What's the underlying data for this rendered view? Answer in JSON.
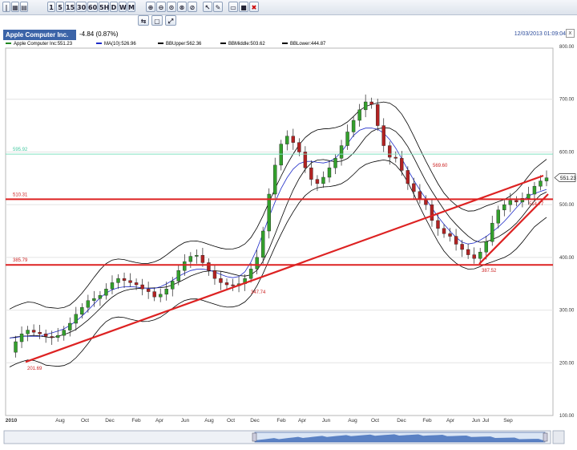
{
  "toolbar": {
    "buttons": [
      "1",
      "5",
      "15",
      "30",
      "60",
      "5H",
      "D",
      "W",
      "M"
    ]
  },
  "header": {
    "symbol": "Apple Computer Inc.",
    "change": "-4.84 (0.87%)",
    "datetime": "12/03/2013 01:09:04",
    "close": "x"
  },
  "legend": [
    {
      "label": "Apple Computer Inc:551.23",
      "color": "#228822"
    },
    {
      "label": "MA(10):526.96",
      "color": "#1f2cc8"
    },
    {
      "label": "BBUpper:562.36",
      "color": "#000000"
    },
    {
      "label": "BBMiddle:503.62",
      "color": "#000000"
    },
    {
      "label": "BBLower:444.87",
      "color": "#000000"
    }
  ],
  "colors": {
    "up": "#33a02c",
    "down": "#b22222",
    "ma": "#1f2cc8",
    "band": "#000000",
    "trend": "#dd2222",
    "cyan": "#7fe0bf"
  },
  "chart_data": {
    "type": "line",
    "title": "Apple Computer Inc",
    "y_ticks": [
      100,
      200,
      300,
      400,
      500,
      600,
      700,
      800
    ],
    "ylim": [
      100,
      830
    ],
    "x_ticks": [
      "2010",
      "Aug",
      "Oct",
      "Dec",
      "Feb",
      "Apr",
      "Jun",
      "Aug",
      "Oct",
      "Dec",
      "Feb",
      "Apr",
      "Jun",
      "Aug",
      "Oct",
      "Dec",
      "Feb",
      "Apr",
      "Jun",
      "Jul",
      "Sep"
    ],
    "last_price": "551.23",
    "horizontal_levels": [
      {
        "label": "595.92",
        "value": 595.92,
        "color": "cyan"
      },
      {
        "label": "510.31",
        "value": 510.31,
        "color": "red"
      },
      {
        "label": "385.79",
        "value": 385.79,
        "color": "red"
      }
    ],
    "annotations": [
      "569.60",
      "387.52",
      "514.77",
      "347.74",
      "201.69"
    ],
    "price_series": [
      220,
      240,
      255,
      262,
      258,
      255,
      250,
      248,
      252,
      262,
      275,
      292,
      305,
      318,
      322,
      328,
      340,
      352,
      360,
      356,
      352,
      348,
      340,
      335,
      325,
      330,
      340,
      355,
      375,
      392,
      402,
      404,
      390,
      375,
      360,
      352,
      348,
      346,
      350,
      360,
      378,
      400,
      450,
      520,
      575,
      615,
      630,
      618,
      600,
      570,
      548,
      540,
      552,
      570,
      588,
      612,
      638,
      660,
      680,
      695,
      690,
      650,
      612,
      590,
      588,
      565,
      540,
      525,
      510,
      500,
      470,
      455,
      445,
      440,
      425,
      415,
      405,
      398,
      410,
      430,
      465,
      490,
      500,
      508,
      505,
      512,
      520,
      535,
      545,
      551
    ]
  }
}
